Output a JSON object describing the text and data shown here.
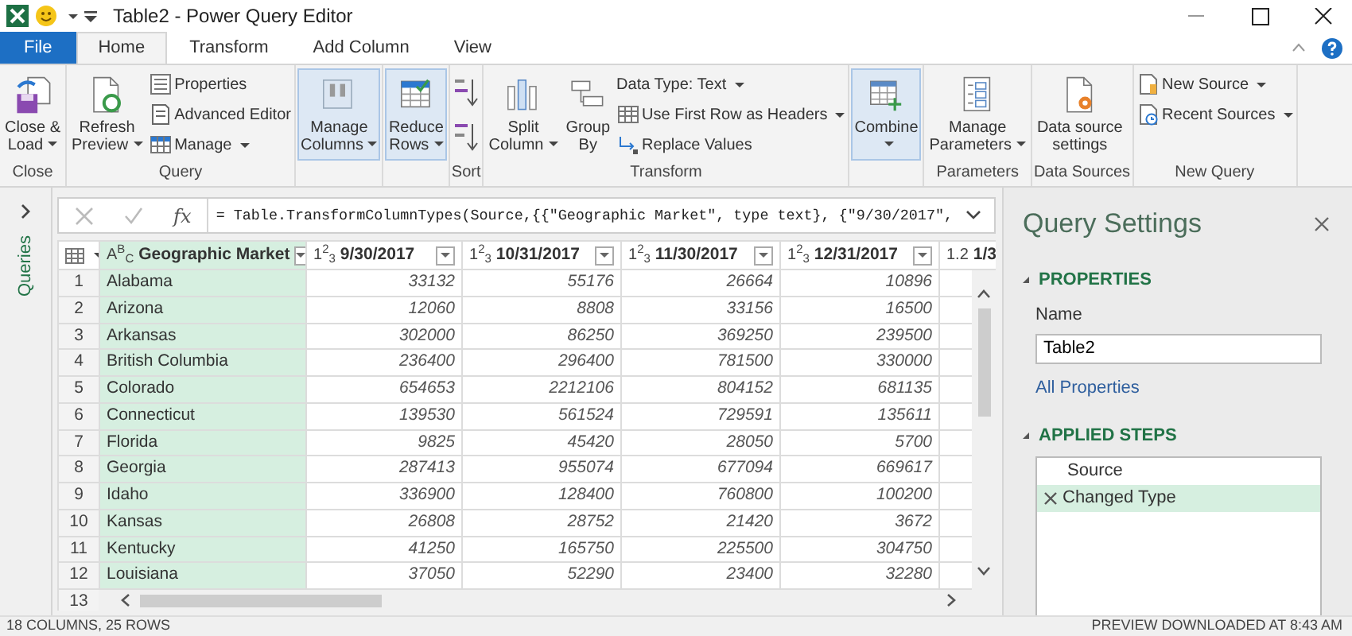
{
  "window": {
    "title": "Table2 - Power Query Editor"
  },
  "ribbon_tabs": [
    {
      "label": "File",
      "kind": "file",
      "selected": false
    },
    {
      "label": "Home",
      "kind": "tab",
      "selected": true
    },
    {
      "label": "Transform",
      "kind": "tab",
      "selected": false
    },
    {
      "label": "Add Column",
      "kind": "tab",
      "selected": false
    },
    {
      "label": "View",
      "kind": "tab",
      "selected": false
    }
  ],
  "ribbon_groups": [
    {
      "label": "Close",
      "commands": [
        {
          "label": "Close &\nLoad",
          "kind": "large",
          "dropdown": true,
          "highlighted": false
        }
      ]
    },
    {
      "label": "Query",
      "commands": [
        {
          "label": "Refresh\nPreview",
          "kind": "large",
          "dropdown": true,
          "highlighted": false
        },
        {
          "label": "Properties",
          "kind": "small",
          "dropdown": false
        },
        {
          "label": "Advanced Editor",
          "kind": "small",
          "dropdown": false
        },
        {
          "label": "Manage",
          "kind": "small",
          "dropdown": true
        }
      ]
    },
    {
      "commands": [
        {
          "label": "Manage\nColumns",
          "kind": "large",
          "dropdown": true,
          "highlighted": true
        }
      ]
    },
    {
      "commands": [
        {
          "label": "Reduce\nRows",
          "kind": "large",
          "dropdown": true,
          "highlighted": true
        }
      ]
    },
    {
      "label": "Sort",
      "commands": [
        {
          "kind": "ascending"
        },
        {
          "kind": "descending"
        }
      ]
    },
    {
      "label": "Transform",
      "commands": [
        {
          "label": "Split\nColumn",
          "kind": "large",
          "dropdown": true,
          "highlighted": false
        },
        {
          "label": "Group\nBy",
          "kind": "large",
          "dropdown": false,
          "highlighted": false
        },
        {
          "label": "Data Type: Text",
          "kind": "small",
          "dropdown": true
        },
        {
          "label": "Use First Row as Headers",
          "kind": "small",
          "dropdown": true
        },
        {
          "label": "Replace Values",
          "kind": "small",
          "dropdown": false
        }
      ]
    },
    {
      "commands": [
        {
          "label": "Combine",
          "kind": "large",
          "dropdown": true,
          "highlighted": true
        }
      ]
    },
    {
      "label": "Parameters",
      "commands": [
        {
          "label": "Manage\nParameters",
          "kind": "large",
          "dropdown": true,
          "highlighted": false
        }
      ]
    },
    {
      "label": "Data Sources",
      "commands": [
        {
          "label": "Data source\nsettings",
          "kind": "large",
          "dropdown": false,
          "highlighted": false
        }
      ]
    },
    {
      "label": "New Query",
      "commands": [
        {
          "label": "New Source",
          "kind": "small",
          "dropdown": true
        },
        {
          "label": "Recent Sources",
          "kind": "small",
          "dropdown": true
        }
      ]
    }
  ],
  "queries_pane": {
    "label": "Queries"
  },
  "formula_bar": {
    "function_label": "fx",
    "formula": "= Table.TransformColumnTypes(Source,{{\"Geographic Market\", type text}, {\"9/30/2017\","
  },
  "table": {
    "columns": [
      {
        "type_label": "A$^{B}$$_{C}$",
        "title": "Geographic Market",
        "selected": true,
        "filter_button": true
      },
      {
        "type_label": "1$^{2}$$_{3}$",
        "title": "9/30/2017",
        "selected": false,
        "filter_button": true
      },
      {
        "type_label": "1$^{2}$$_{3}$",
        "title": "10/31/2017",
        "selected": false,
        "filter_button": true
      },
      {
        "type_label": "1$^{2}$$_{3}$",
        "title": "11/30/2017",
        "selected": false,
        "filter_button": true
      },
      {
        "type_label": "1$^{2}$$_{3}$",
        "title": "12/31/2017",
        "selected": false,
        "filter_button": true
      },
      {
        "type_label": "1.2",
        "title": "1/3",
        "selected": false,
        "filter_button": false
      }
    ],
    "rows": [
      {
        "number": "1",
        "cells": [
          "Alabama",
          "33132",
          "55176",
          "26664",
          "10896"
        ]
      },
      {
        "number": "2",
        "cells": [
          "Arizona",
          "12060",
          "8808",
          "33156",
          "16500"
        ]
      },
      {
        "number": "3",
        "cells": [
          "Arkansas",
          "302000",
          "86250",
          "369250",
          "239500"
        ]
      },
      {
        "number": "4",
        "cells": [
          "British Columbia",
          "236400",
          "296400",
          "781500",
          "330000"
        ]
      },
      {
        "number": "5",
        "cells": [
          "Colorado",
          "654653",
          "2212106",
          "804152",
          "681135"
        ]
      },
      {
        "number": "6",
        "cells": [
          "Connecticut",
          "139530",
          "561524",
          "729591",
          "135611"
        ]
      },
      {
        "number": "7",
        "cells": [
          "Florida",
          "9825",
          "45420",
          "28050",
          "5700"
        ]
      },
      {
        "number": "8",
        "cells": [
          "Georgia",
          "287413",
          "955074",
          "677094",
          "669617"
        ]
      },
      {
        "number": "9",
        "cells": [
          "Idaho",
          "336900",
          "128400",
          "760800",
          "100200"
        ]
      },
      {
        "number": "10",
        "cells": [
          "Kansas",
          "26808",
          "28752",
          "21420",
          "3672"
        ]
      },
      {
        "number": "11",
        "cells": [
          "Kentucky",
          "41250",
          "165750",
          "225500",
          "304750"
        ]
      },
      {
        "number": "12",
        "cells": [
          "Louisiana",
          "37050",
          "52290",
          "23400",
          "32280"
        ]
      },
      {
        "number": "13"
      }
    ]
  },
  "query_settings": {
    "title": "Query Settings",
    "properties": {
      "heading": "PROPERTIES",
      "expanded": true,
      "name_label": "Name",
      "name_value": "Table2",
      "link": "All Properties"
    },
    "applied_steps": {
      "heading": "APPLIED STEPS",
      "expanded": true,
      "steps": [
        {
          "label": "Source",
          "selected": false
        },
        {
          "label": "Changed Type",
          "selected": true
        }
      ]
    }
  },
  "status_bar": {
    "left": "18 COLUMNS, 25 ROWS",
    "right": "PREVIEW DOWNLOADED AT 8:43 AM"
  }
}
